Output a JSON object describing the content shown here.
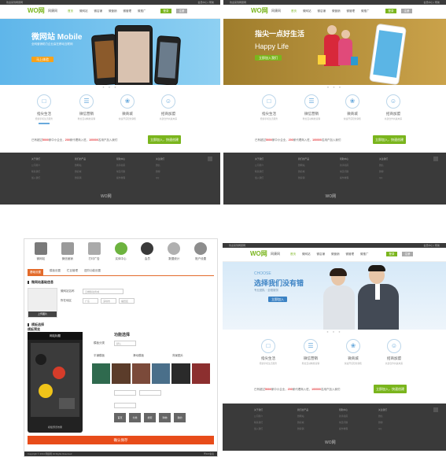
{
  "brand": {
    "logo": "WO网",
    "tagline": "网康网",
    "green": "#7ab51d",
    "red": "#e84c1a"
  },
  "topbar": {
    "left": "欢迎来到网康网",
    "right": "会员中心 | 帮助"
  },
  "nav": {
    "items": [
      "首页",
      "微网站",
      "微店铺",
      "微营销",
      "微管理",
      "微推广"
    ],
    "login": "登录",
    "register": "注册"
  },
  "banner1": {
    "title": "微网站 Mobile",
    "subtitle": "全网营销助力企业赢在移动互联网",
    "cta": "马上体验"
  },
  "banner2": {
    "title": "指尖一点好生活",
    "slogan": "Happy Life",
    "cta": "立即加入我们"
  },
  "banner4": {
    "choose": "CHOOSE",
    "title": "选择我们没有错",
    "sub": "专业团队 · 全程服务",
    "cta": "立即加入"
  },
  "features": [
    {
      "icon": "phone-icon",
      "glyph": "□",
      "title": "指尖生活",
      "desc": "便捷手机生活服务"
    },
    {
      "icon": "chat-icon",
      "glyph": "☰",
      "title": "微信营销",
      "desc": "粉丝互动精准营销"
    },
    {
      "icon": "mall-icon",
      "glyph": "❀",
      "title": "微商城",
      "desc": "快速开店轻松销售"
    },
    {
      "icon": "user-icon",
      "glyph": "☺",
      "title": "招商加盟",
      "desc": "共建合作共赢未来"
    }
  ],
  "stats": {
    "prefix": "已有超过",
    "n1": "5000",
    "mid1": "家中小企业，",
    "n2": "200",
    "mid2": "家代理商入驻，",
    "n3": "100000",
    "suffix": "名用户加入我们",
    "button": "立即加入，快速创建"
  },
  "footer": {
    "cols": [
      {
        "h": "关于我们",
        "items": [
          "公司简介",
          "联系我们",
          "加入我们"
        ]
      },
      {
        "h": "我们的产品",
        "items": [
          "微网站",
          "微商城",
          "微营销"
        ]
      },
      {
        "h": "帮助中心",
        "items": [
          "新手指南",
          "常见问题",
          "操作教程"
        ]
      },
      {
        "h": "关注我们",
        "items": [
          "微信",
          "微博",
          "QQ"
        ]
      }
    ],
    "logo": "WO网"
  },
  "editor": {
    "tabs": [
      {
        "label": "微网站",
        "icon": "grid-icon"
      },
      {
        "label": "微信营销",
        "icon": "chat-icon"
      },
      {
        "label": "打印广告",
        "icon": "printer-icon"
      },
      {
        "label": "实体中心",
        "icon": "dollar-icon"
      },
      {
        "label": "会员",
        "icon": "user-icon"
      },
      {
        "label": "数据统计",
        "icon": "pie-icon"
      },
      {
        "label": "账户设置",
        "icon": "gear-icon"
      }
    ],
    "subtabs": [
      "基础设置",
      "模板设置",
      "栏目管理",
      "进阶功能设置"
    ],
    "section1": "微网站基础信息",
    "section2": "模板选择",
    "upload": "上传图片",
    "form": {
      "name_label": "微网站名称",
      "name_value": "云端移动商城",
      "area_label": "所在地区",
      "province": "广东",
      "city": "深圳市",
      "district": "福田区"
    },
    "preview_title": "模板预览",
    "phone_title": "网站标题",
    "phone_caption": "模板预览效果",
    "func_title": "功能选择",
    "func_labels": [
      "模板分类",
      "默认",
      "平铺模板",
      "滑动模板",
      "背景图片"
    ],
    "minis": [
      "首页",
      "分类",
      "搜索",
      "购物",
      "我的"
    ],
    "save": "确认保存",
    "footer_left": "Copyright © 2014 网康网 All Rights Reserved",
    "footer_right": "粤ICP备案"
  }
}
